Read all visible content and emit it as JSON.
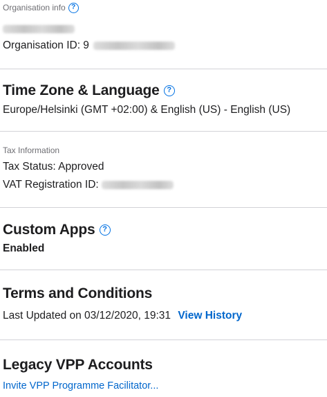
{
  "org_info": {
    "label": "Organisation info",
    "org_id_label": "Organisation ID: 9"
  },
  "time_zone": {
    "title": "Time Zone & Language",
    "value": "Europe/Helsinki (GMT +02:00) & English (US) - English (US)"
  },
  "tax": {
    "label": "Tax Information",
    "status": "Tax Status: Approved",
    "vat_label": "VAT Registration ID:"
  },
  "custom_apps": {
    "title": "Custom Apps",
    "status": "Enabled"
  },
  "terms": {
    "title": "Terms and Conditions",
    "updated": "Last Updated on 03/12/2020, 19:31",
    "history_link": "View History"
  },
  "legacy": {
    "title": "Legacy VPP Accounts",
    "invite_link": "Invite VPP Programme Facilitator..."
  },
  "help_icon_glyph": "?"
}
